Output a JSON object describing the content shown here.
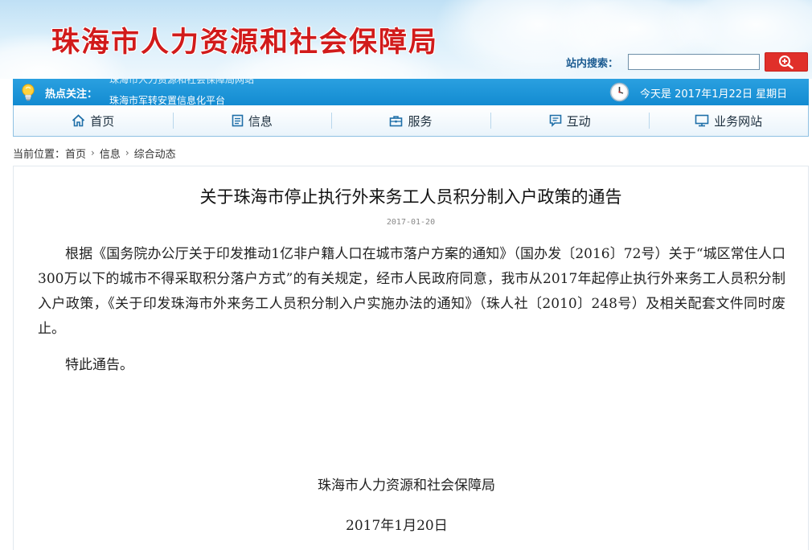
{
  "header": {
    "site_title": "珠海市人力资源和社会保障局",
    "search_label": "站内搜索：",
    "search_value": "",
    "search_icon": "magnifier-plus-icon"
  },
  "hotbar": {
    "label": "热点关注：",
    "news": [
      "珠海市人力资源和社会保障局网站",
      "珠海市军转安置信息化平台"
    ],
    "today": "今天是  2017年1月22日  星期日",
    "colors": {
      "bar": "#138bd1",
      "title": "#d11b1b",
      "search_button": "#e0302a"
    }
  },
  "nav": {
    "items": [
      {
        "label": "首页",
        "icon": "home-icon"
      },
      {
        "label": "信息",
        "icon": "document-icon"
      },
      {
        "label": "服务",
        "icon": "briefcase-icon"
      },
      {
        "label": "互动",
        "icon": "chat-icon"
      },
      {
        "label": "业务网站",
        "icon": "monitor-icon"
      }
    ]
  },
  "breadcrumb": {
    "prefix": "当前位置：",
    "items": [
      "首页",
      "信息",
      "综合动态"
    ],
    "separator": "›"
  },
  "article": {
    "title": "关于珠海市停止执行外来务工人员积分制入户政策的通告",
    "date": "2017-01-20",
    "paragraphs": [
      "根据《国务院办公厅关于印发推动1亿非户籍人口在城市落户方案的通知》（国办发〔2016〕72号）关于“城区常住人口300万以下的城市不得采取积分落户方式”的有关规定，经市人民政府同意，我市从2017年起停止执行外来务工人员积分制入户政策，《关于印发珠海市外来务工人员积分制入户实施办法的通知》（珠人社〔2010〕248号）及相关配套文件同时废止。",
      "特此通告。"
    ],
    "signature_org": "珠海市人力资源和社会保障局",
    "signature_date": "2017年1月20日"
  }
}
